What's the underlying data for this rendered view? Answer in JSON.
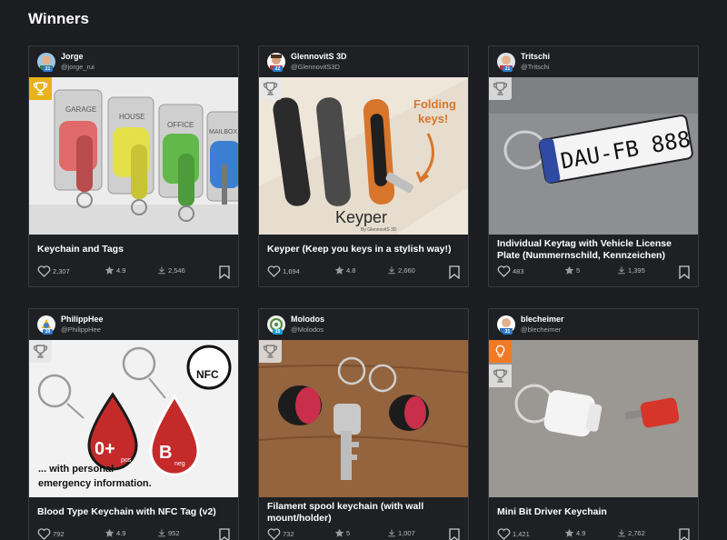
{
  "page": {
    "title": "Winners"
  },
  "colors": {
    "background": "#1c1d21",
    "card": "#1f2024",
    "border": "#3a3b40",
    "gold_award": "#e8b21a",
    "orange_award": "#f07a26"
  },
  "cards": [
    {
      "author": "Jorge",
      "handle": "@jorge_rui",
      "level": "21",
      "title": "Keychain and Tags",
      "likes": "2,307",
      "rating": "4.9",
      "downloads": "2,546",
      "award": "gold-trophy-icon",
      "thumb_texts": [
        "GARAGE",
        "HOUSE",
        "OFFICE",
        "MAILBOX",
        "GARAGE",
        "HOUSE",
        "OFFICE"
      ]
    },
    {
      "author": "GlennovitS 3D",
      "handle": "@GlennovitS3D",
      "level": "22",
      "title": "Keyper (Keep you keys in a stylish way!)",
      "likes": "1,694",
      "rating": "4.8",
      "downloads": "2,660",
      "award": "grey-trophy-icon",
      "thumb_texts": [
        "Folding",
        "keys!",
        "Keyper",
        "By GlennovitS 3D"
      ]
    },
    {
      "author": "Tritschi",
      "handle": "@Tritschi",
      "level": "21",
      "title": "Individual Keytag with Vehicle License Plate (Nummernschild, Kennzeichen)",
      "likes": "483",
      "rating": "5",
      "downloads": "1,395",
      "award": "grey-trophy-icon",
      "thumb_texts": [
        "DAU-FB 888"
      ]
    },
    {
      "author": "PhilippHee",
      "handle": "@PhilippHee",
      "level": "20",
      "title": "Blood Type Keychain with NFC Tag (v2)",
      "likes": "792",
      "rating": "4.9",
      "downloads": "952",
      "award": "grey-trophy-icon",
      "thumb_texts": [
        "NFC",
        "0+",
        "pos",
        "B",
        "neg",
        "... with personal",
        "emergency information."
      ]
    },
    {
      "author": "Molodos",
      "handle": "@Molodos",
      "level": "19",
      "title": "Filament spool keychain (with wall mount/holder)",
      "likes": "732",
      "rating": "5",
      "downloads": "1,007",
      "award": "grey-trophy-icon",
      "thumb_texts": []
    },
    {
      "author": "blecheimer",
      "handle": "@blecheimer",
      "level": "21",
      "title": "Mini Bit Driver Keychain",
      "likes": "1,421",
      "rating": "4.9",
      "downloads": "2,762",
      "award": "orange-bulb-icon",
      "thumb_texts": []
    }
  ]
}
